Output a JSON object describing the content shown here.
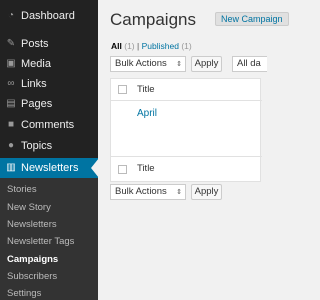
{
  "sidebar": {
    "items": [
      {
        "label": "Dashboard",
        "icon": "dashboard-icon"
      },
      {
        "label": "Posts",
        "icon": "pin-icon"
      },
      {
        "label": "Media",
        "icon": "media-icon"
      },
      {
        "label": "Links",
        "icon": "links-icon"
      },
      {
        "label": "Pages",
        "icon": "pages-icon"
      },
      {
        "label": "Comments",
        "icon": "comments-icon"
      },
      {
        "label": "Topics",
        "icon": "topics-icon"
      },
      {
        "label": "Newsletters",
        "icon": "newsletters-icon"
      }
    ],
    "submenu": [
      "Stories",
      "New Story",
      "Newsletters",
      "Newsletter Tags",
      "Campaigns",
      "Subscribers",
      "Settings"
    ],
    "active_color": "#0074a2"
  },
  "main": {
    "title": "Campaigns",
    "new_button": "New Campaign",
    "filters": {
      "all_label": "All",
      "all_count": "(1)",
      "separator": "|",
      "published_label": "Published",
      "published_count": "(1)"
    },
    "bulk_actions_label": "Bulk Actions",
    "apply_label": "Apply",
    "dates_partial": "All da",
    "column_title": "Title",
    "rows": [
      {
        "title": "April"
      }
    ]
  }
}
